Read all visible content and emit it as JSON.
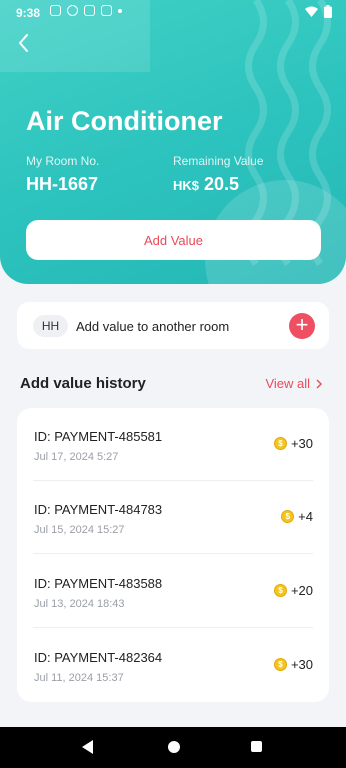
{
  "status_bar": {
    "time": "9:38"
  },
  "header": {
    "title": "Air Conditioner",
    "room_label": "My Room No.",
    "room_value": "HH-1667",
    "remaining_label": "Remaining Value",
    "currency": "HK$",
    "remaining_value": "20.5",
    "add_value_label": "Add Value"
  },
  "another_room": {
    "chip": "HH",
    "label": "Add value to another room"
  },
  "history": {
    "title": "Add value history",
    "view_all": "View all",
    "items": [
      {
        "id": "ID: PAYMENT-485581",
        "date": "Jul 17, 2024 5:27",
        "amount": "+30"
      },
      {
        "id": "ID: PAYMENT-484783",
        "date": "Jul 15, 2024 15:27",
        "amount": "+4"
      },
      {
        "id": "ID: PAYMENT-483588",
        "date": "Jul 13, 2024 18:43",
        "amount": "+20"
      },
      {
        "id": "ID: PAYMENT-482364",
        "date": "Jul 11, 2024 15:37",
        "amount": "+30"
      }
    ]
  },
  "colors": {
    "accent": "#2cc2bd",
    "action_red": "#e84b5a",
    "coin": "#f4c51d"
  },
  "icons": [
    "back-arrow-icon",
    "plus-icon",
    "chevron-right-icon",
    "coin-icon",
    "wifi-icon",
    "battery-icon"
  ]
}
